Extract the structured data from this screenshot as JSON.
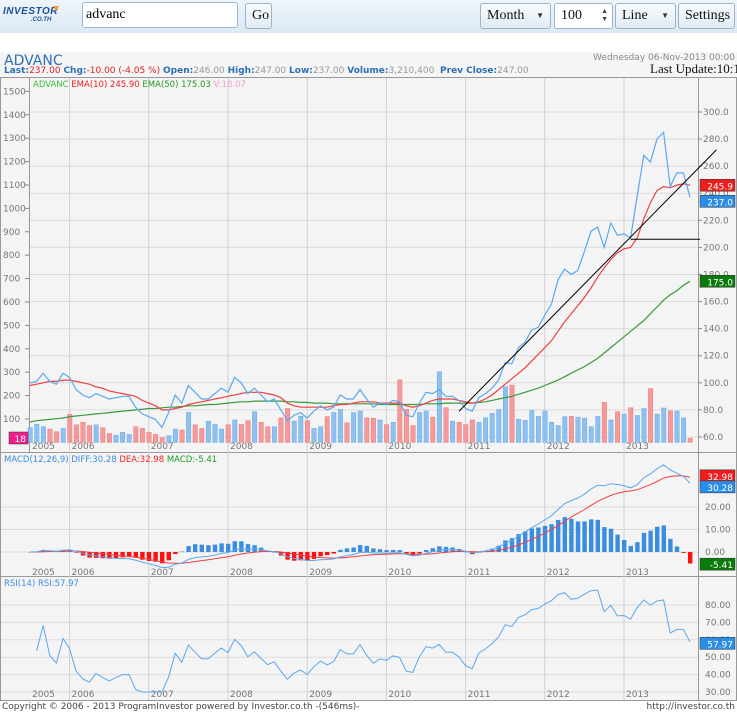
{
  "toolbar": {
    "logo": "INVESTOR.CO.TH",
    "logo_main": "INVESTOR",
    "logo_sub": ".CO.TH",
    "search_value": "advanc",
    "go_label": "Go",
    "period_select": "Month",
    "count_value": "100",
    "chart_type_select": "Line",
    "settings_label": "Settings"
  },
  "header": {
    "symbol": "ADVANC",
    "date": "Wednesday 06-Nov-2013 00:00",
    "last_update": "Last Update:10:1",
    "last_label": "Last:",
    "last_value": "237.00",
    "chg_label": "Chg:",
    "chg_value": "-10.00 (-4.05 %)",
    "open_label": "Open:",
    "open_value": "246.00",
    "high_label": "High:",
    "high_value": "247.00",
    "low_label": "Low:",
    "low_value": "237.00",
    "volume_label": "Volume:",
    "volume_value": "3,210,400",
    "prev_label": "Prev Close:",
    "prev_value": "247.00"
  },
  "legend": {
    "symbol": "ADVANC",
    "ema10": "EMA(10) 245.90",
    "ema50": "EMA(50) 175.03",
    "vol": "V:18.07",
    "macd_name": "MACD(12,26,9)",
    "diff": "DIFF:30.28",
    "dea": "DEA:32.98",
    "macd": "MACD:-5.41",
    "rsi": "RSI(14) RSI:57.97"
  },
  "tags": {
    "ema10": "245.9",
    "close": "237.0",
    "ema50": "175.0",
    "volume": "18",
    "dea": "32.98",
    "diff": "30.28",
    "macd": "-5.41",
    "rsi": "57.97"
  },
  "colors": {
    "price": "#5aa8f0",
    "ema10": "#f04040",
    "ema50": "#3a9a3a",
    "vol_up": "#8ec1f0",
    "vol_down": "#f49a9a",
    "macd_up": "#3a8de0",
    "macd_down": "#ff1010",
    "tag_red": "#ee1c1c",
    "tag_blue": "#2a8de8",
    "tag_green": "#0a7a0a",
    "tag_pink": "#ee1e8a"
  },
  "chart_data": {
    "type": "line",
    "interval": "month",
    "x_start": "2005-07",
    "x_end": "2013-11",
    "year_labels": [
      "2005",
      "2006",
      "2007",
      "2008",
      "2009",
      "2010",
      "2011",
      "2012",
      "2013"
    ],
    "price_axis": {
      "ylim": [
        60,
        300
      ],
      "ticks": [
        "300.0",
        "280.0",
        "260.0",
        "240.0",
        "220.0",
        "200.0",
        "180.0",
        "160.0",
        "140.0",
        "120.0",
        "100.0",
        "80.0",
        "60.0"
      ]
    },
    "volume_axis": {
      "ticks": [
        "1500",
        "1400",
        "1300",
        "1200",
        "1100",
        "1000",
        "900",
        "800",
        "700",
        "600",
        "500",
        "400",
        "300",
        "200",
        "100"
      ]
    },
    "close": [
      100,
      101,
      107,
      101,
      99,
      107,
      104,
      95,
      91,
      89,
      92,
      90,
      88,
      89,
      90,
      90,
      82,
      77,
      75,
      73,
      67,
      78,
      91,
      85,
      98,
      93,
      88,
      88,
      92,
      96,
      93,
      104,
      100,
      92,
      96,
      91,
      86,
      88,
      80,
      72,
      76,
      78,
      74,
      79,
      83,
      80,
      82,
      91,
      88,
      88,
      95,
      88,
      82,
      85,
      84,
      87,
      86,
      76,
      75,
      85,
      93,
      92,
      95,
      90,
      90,
      87,
      81,
      79,
      89,
      92,
      96,
      102,
      115,
      114,
      126,
      130,
      139,
      141,
      150,
      158,
      176,
      184,
      180,
      183,
      197,
      212,
      215,
      200,
      218,
      209,
      210,
      207,
      238,
      268,
      263,
      280,
      285,
      245,
      255,
      255,
      237
    ],
    "ema10": [
      98,
      99,
      100,
      101,
      101,
      102,
      102,
      101,
      100,
      99,
      97,
      96,
      94,
      93,
      92,
      91,
      90,
      87,
      85,
      83,
      80,
      80,
      81,
      82,
      84,
      85,
      86,
      87,
      88,
      89,
      90,
      91,
      92,
      93,
      93,
      93,
      92,
      91,
      89,
      85,
      83,
      82,
      82,
      82,
      82,
      82,
      83,
      84,
      84,
      85,
      86,
      86,
      86,
      85,
      85,
      85,
      85,
      83,
      82,
      83,
      85,
      87,
      88,
      88,
      88,
      87,
      86,
      85,
      86,
      88,
      91,
      95,
      99,
      103,
      107,
      111,
      116,
      121,
      126,
      131,
      138,
      145,
      151,
      157,
      163,
      170,
      178,
      185,
      191,
      196,
      199,
      200,
      207,
      221,
      233,
      242,
      245,
      244,
      246,
      247,
      245.9
    ],
    "ema50": [
      71,
      72,
      72.5,
      73,
      73.5,
      74,
      75,
      75.5,
      76,
      76.5,
      77,
      77.5,
      78,
      78.5,
      79,
      79.5,
      80,
      80.5,
      81,
      81,
      81.5,
      82,
      82,
      82.5,
      83,
      83,
      83.5,
      84,
      84,
      84.5,
      85,
      85.5,
      86,
      86,
      86.5,
      86.5,
      86.5,
      86.5,
      86.5,
      86,
      86,
      85.5,
      85.5,
      85,
      85,
      85,
      84.5,
      84.5,
      84.5,
      84.5,
      84.5,
      84.5,
      84.5,
      84,
      84,
      84,
      84,
      84,
      84,
      84,
      84.5,
      84.5,
      84.5,
      85,
      85,
      85,
      85,
      85,
      85.5,
      86,
      87,
      88,
      89,
      90,
      91.5,
      93,
      94.5,
      96,
      98,
      100,
      102,
      104.5,
      107,
      109.5,
      112,
      115,
      118,
      122,
      126,
      130,
      134,
      138,
      142,
      146,
      151,
      156,
      161,
      165,
      168,
      172,
      175
    ],
    "volume": [
      63,
      78,
      67,
      57,
      46,
      60,
      120,
      75,
      86,
      72,
      75,
      63,
      38,
      31,
      43,
      34,
      67,
      60,
      43,
      34,
      20,
      28,
      57,
      53,
      128,
      75,
      60,
      91,
      78,
      57,
      75,
      96,
      77,
      93,
      131,
      86,
      67,
      67,
      105,
      145,
      91,
      112,
      93,
      60,
      67,
      110,
      128,
      141,
      84,
      127,
      134,
      105,
      103,
      96,
      76,
      86,
      267,
      141,
      72,
      128,
      134,
      108,
      302,
      148,
      91,
      86,
      76,
      96,
      86,
      105,
      124,
      141,
      238,
      245,
      99,
      94,
      137,
      112,
      134,
      86,
      72,
      110,
      112,
      108,
      104,
      67,
      112,
      171,
      96,
      131,
      121,
      148,
      115,
      145,
      230,
      121,
      147,
      135,
      134,
      105,
      18
    ],
    "annotations": [
      {
        "type": "trendline",
        "from": [
          "2010-12",
          79
        ],
        "to": [
          "2014-03",
          272
        ]
      },
      {
        "type": "horizontal",
        "from": [
          "2013-02",
          206
        ]
      }
    ],
    "macd_panel": {
      "params": [
        12,
        26,
        9
      ],
      "ticks": [
        "20.00",
        "10.00",
        "0.00"
      ],
      "diff_last": 30.28,
      "dea_last": 32.98,
      "macd_last": -5.41
    },
    "rsi_panel": {
      "period": 14,
      "ticks": [
        "80.00",
        "70.00",
        "60.00",
        "50.00",
        "40.00",
        "30.00"
      ],
      "rsi_last": 57.97
    }
  },
  "footer": {
    "copyright": "Copyright © 2006 - 2013 ProgramInvestor powered by Investor.co.th -(546ms)-",
    "url": "http://investor.co.th"
  }
}
